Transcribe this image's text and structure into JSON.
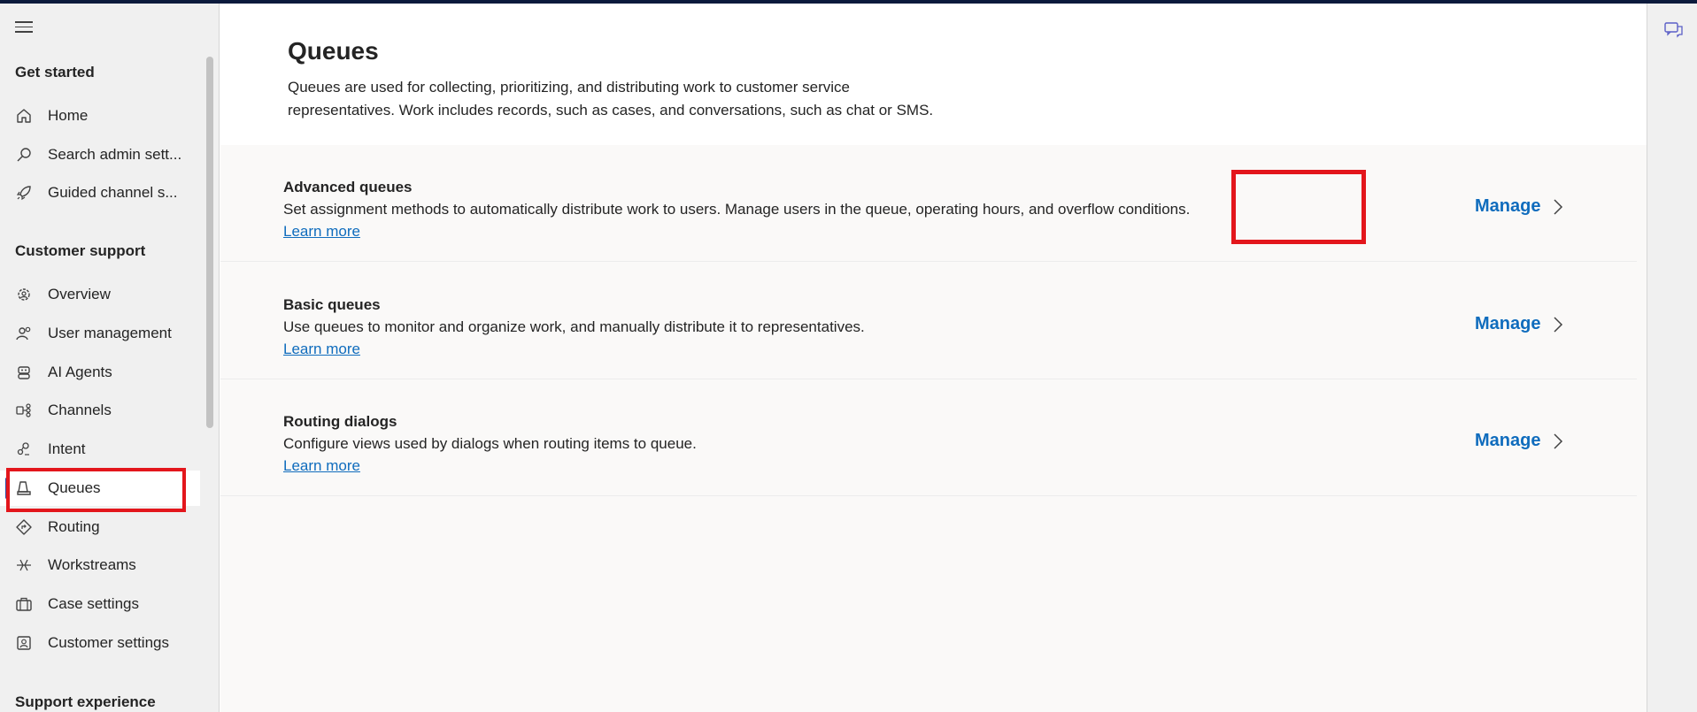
{
  "sidebar": {
    "sections": [
      {
        "title": "Get started"
      },
      {
        "title": "Customer support"
      },
      {
        "title": "Support experience"
      }
    ],
    "items": [
      {
        "label": "Home",
        "icon": "home-icon"
      },
      {
        "label": "Search admin sett...",
        "icon": "search-icon"
      },
      {
        "label": "Guided channel s...",
        "icon": "rocket-icon"
      },
      {
        "label": "Overview",
        "icon": "gear-people-icon"
      },
      {
        "label": "User management",
        "icon": "people-icon"
      },
      {
        "label": "AI Agents",
        "icon": "bot-icon"
      },
      {
        "label": "Channels",
        "icon": "channels-icon"
      },
      {
        "label": "Intent",
        "icon": "intent-icon"
      },
      {
        "label": "Queues",
        "icon": "queue-icon"
      },
      {
        "label": "Routing",
        "icon": "routing-icon"
      },
      {
        "label": "Workstreams",
        "icon": "workstreams-icon"
      },
      {
        "label": "Case settings",
        "icon": "briefcase-icon"
      },
      {
        "label": "Customer settings",
        "icon": "contact-card-icon"
      }
    ],
    "selected": "Queues"
  },
  "main": {
    "title": "Queues",
    "description": "Queues are used for collecting, prioritizing, and distributing work to customer service representatives. Work includes records, such as cases, and conversations, such as chat or SMS.",
    "cards": [
      {
        "title": "Advanced queues",
        "description": "Set assignment methods to automatically distribute work to users. Manage users in the queue, operating hours, and overflow conditions.",
        "link": "Learn more",
        "action": "Manage"
      },
      {
        "title": "Basic queues",
        "description": "Use queues to monitor and organize work, and manually distribute it to representatives.",
        "link": "Learn more",
        "action": "Manage"
      },
      {
        "title": "Routing dialogs",
        "description": "Configure views used by dialogs when routing items to queue.",
        "link": "Learn more",
        "action": "Manage"
      }
    ]
  },
  "colors": {
    "accent": "#0f6cbd",
    "highlight": "#e3161c",
    "topbar": "#0b1a3c"
  }
}
